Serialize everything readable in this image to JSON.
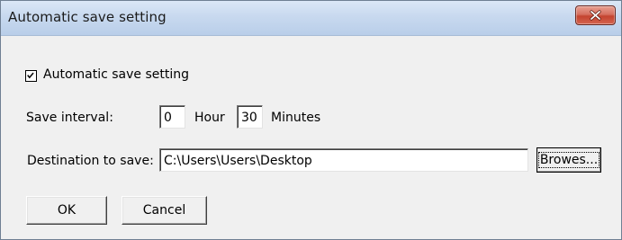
{
  "window": {
    "title": "Automatic save setting"
  },
  "auto_save": {
    "checkbox_label": "Automatic save setting",
    "checked": true
  },
  "interval": {
    "label": "Save interval:",
    "hours_value": "0",
    "hours_unit": "Hour",
    "minutes_value": "30",
    "minutes_unit": "Minutes"
  },
  "destination": {
    "label": "Destination to save:",
    "path": "C:\\Users\\Users\\Desktop",
    "browse_label": "Browes..."
  },
  "buttons": {
    "ok_label": "OK",
    "cancel_label": "Cancel"
  },
  "colors": {
    "titlebar_top": "#dbe7f6",
    "titlebar_bottom": "#b9cee9",
    "close_button": "#c4432f",
    "dialog_face": "#f0f0f0"
  },
  "icons": {
    "close": "close-icon",
    "checkmark": "checkmark-icon"
  }
}
